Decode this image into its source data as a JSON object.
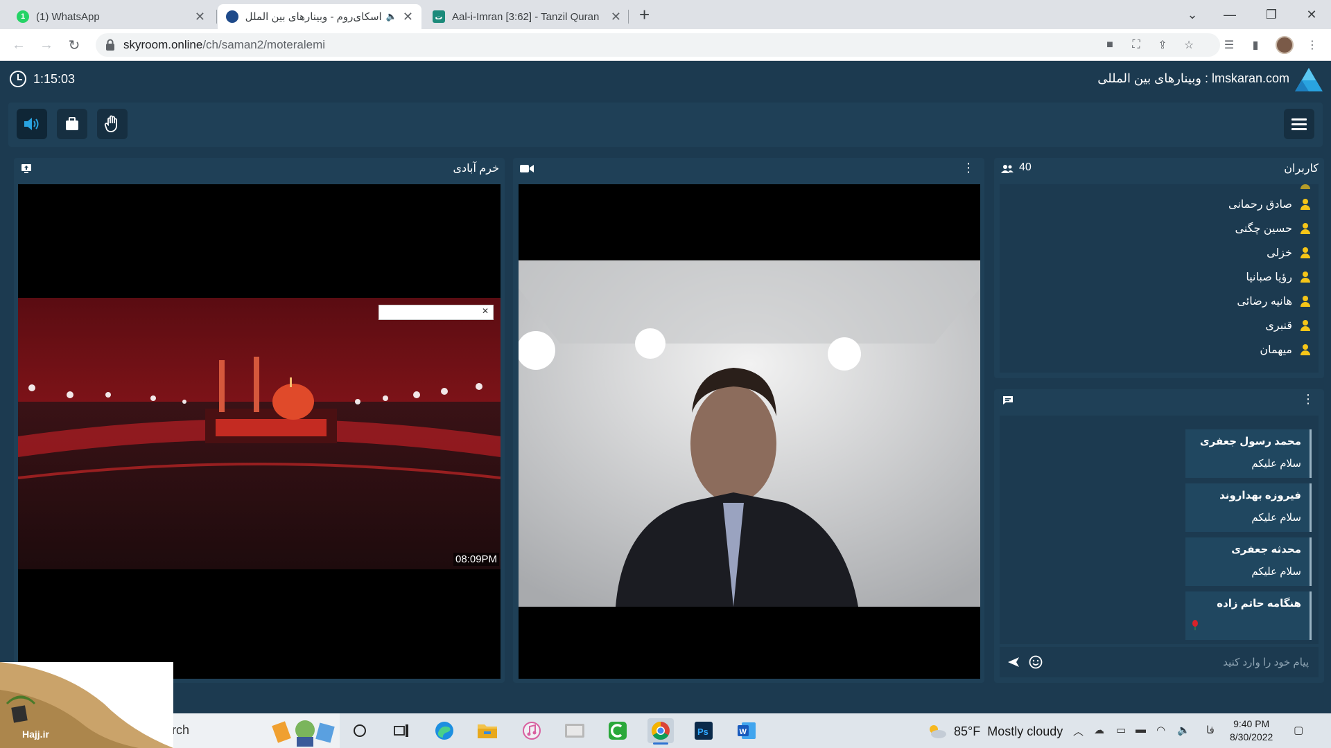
{
  "browser": {
    "tabs": [
      {
        "label": "(1) WhatsApp",
        "icon": "whatsapp-icon",
        "active": false
      },
      {
        "label": "اسکای‌روم - وبینارهای بین الملل",
        "icon": "skyroom-icon",
        "active": true
      },
      {
        "label": "Aal-i-Imran [3:62] - Tanzil Quran",
        "icon": "tanzil-icon",
        "active": false
      }
    ],
    "url_host": "skyroom.online",
    "url_path": "/ch/saman2/moteralemi"
  },
  "header": {
    "timer": "1:15:03",
    "site_title": "lmskaran.com : وبینارهای بین المللی"
  },
  "left_panel": {
    "title": "خرم آبادی",
    "video_timestamp": "08:09PM"
  },
  "users_panel": {
    "title": "کاربران",
    "count": "40",
    "users": [
      "صادق رحمانی",
      "حسین چگنی",
      "خزلی",
      "رؤیا صبانیا",
      "هانیه رضائی",
      "قنبری",
      "میهمان"
    ]
  },
  "chat_panel": {
    "messages": [
      {
        "sender": "محمد رسول جعفری",
        "body": "سلام علیکم"
      },
      {
        "sender": "فیروزه بهداروند",
        "body": "سلام علیکم"
      },
      {
        "sender": "محدثه جعفری",
        "body": "سلام علیکم"
      },
      {
        "sender": "هنگامه حاتم زاده",
        "body": ""
      }
    ],
    "input_placeholder": "پیام خود را وارد کنید"
  },
  "taskbar": {
    "search_text": "rch",
    "weather_temp": "85°F",
    "weather_desc": "Mostly cloudy",
    "lang": "فا",
    "time": "9:40 PM",
    "date": "8/30/2022"
  },
  "watermark": {
    "text": "Hajj.ir"
  },
  "colors": {
    "app_bg": "#1c3a50",
    "panel_bg": "#1f4057",
    "user_icon": "#f5c518",
    "accent_blue": "#29a3e0"
  }
}
